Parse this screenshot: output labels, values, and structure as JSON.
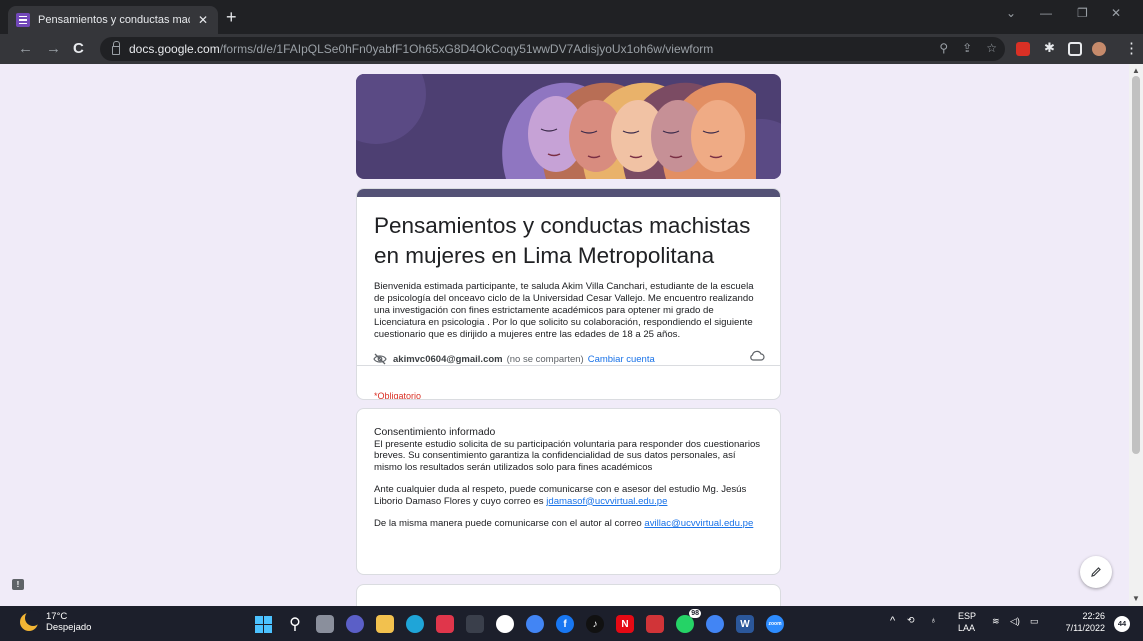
{
  "browser": {
    "tab_title": "Pensamientos y conductas machi",
    "tab_close": "✕",
    "new_tab": "+",
    "url_host": "docs.google.com",
    "url_path": "/forms/d/e/1FAIpQLSe0hFn0yabfF1Oh65xG8D4OkCoqy51wwDV7AdisjyoUx1oh6w/viewform",
    "accent_color": "#7248b9"
  },
  "form": {
    "title": "Pensamientos y conductas machistas en mujeres en Lima Metropolitana",
    "description": "Bienvenida estimada  participante, te saluda Akim Villa Canchari, estudiante de la escuela de psicología del onceavo ciclo de la Universidad Cesar Vallejo. Me encuentro realizando una investigación con fines estrictamente académicos para optener mi grado de Licenciatura en psicologia . Por lo que solicito su colaboración, respondiendo el siguiente cuestionario que es dirijido a mujeres entre las edades de 18 a 25 años.",
    "account_email": "akimvc0604@gmail.com",
    "account_note": "(no se comparten)",
    "switch_account": "Cambiar cuenta",
    "required_note": "*Obligatorio",
    "header_color": "#545276",
    "background_color": "#f0ebf8"
  },
  "consent": {
    "heading": "Consentimiento informado",
    "paragraph1": "El presente estudio  solicita de su participación voluntaria para responder dos cuestionarios breves. Su consentimiento garantiza la confidencialidad de sus datos personales, así mismo los resultados serán utilizados solo para fines académicos",
    "paragraph2_text": "Ante cualquier duda al respeto, puede comunicarse con e asesor del estudio Mg. Jesús Liborio Damaso Flores y cuyo correo es ",
    "paragraph2_link": "jdamasof@ucvvirtual.edu.pe",
    "paragraph3_text": "De la misma manera  puede comunicarse con el autor  al  correo ",
    "paragraph3_link": "avillac@ucvvirtual.edu.pe"
  },
  "taskbar": {
    "temperature": "17°C",
    "weather": "Despejado",
    "whatsapp_badge": "98",
    "language": "ESP",
    "layout": "LAA",
    "time": "22:26",
    "date": "7/11/2022",
    "notifications": "44"
  }
}
